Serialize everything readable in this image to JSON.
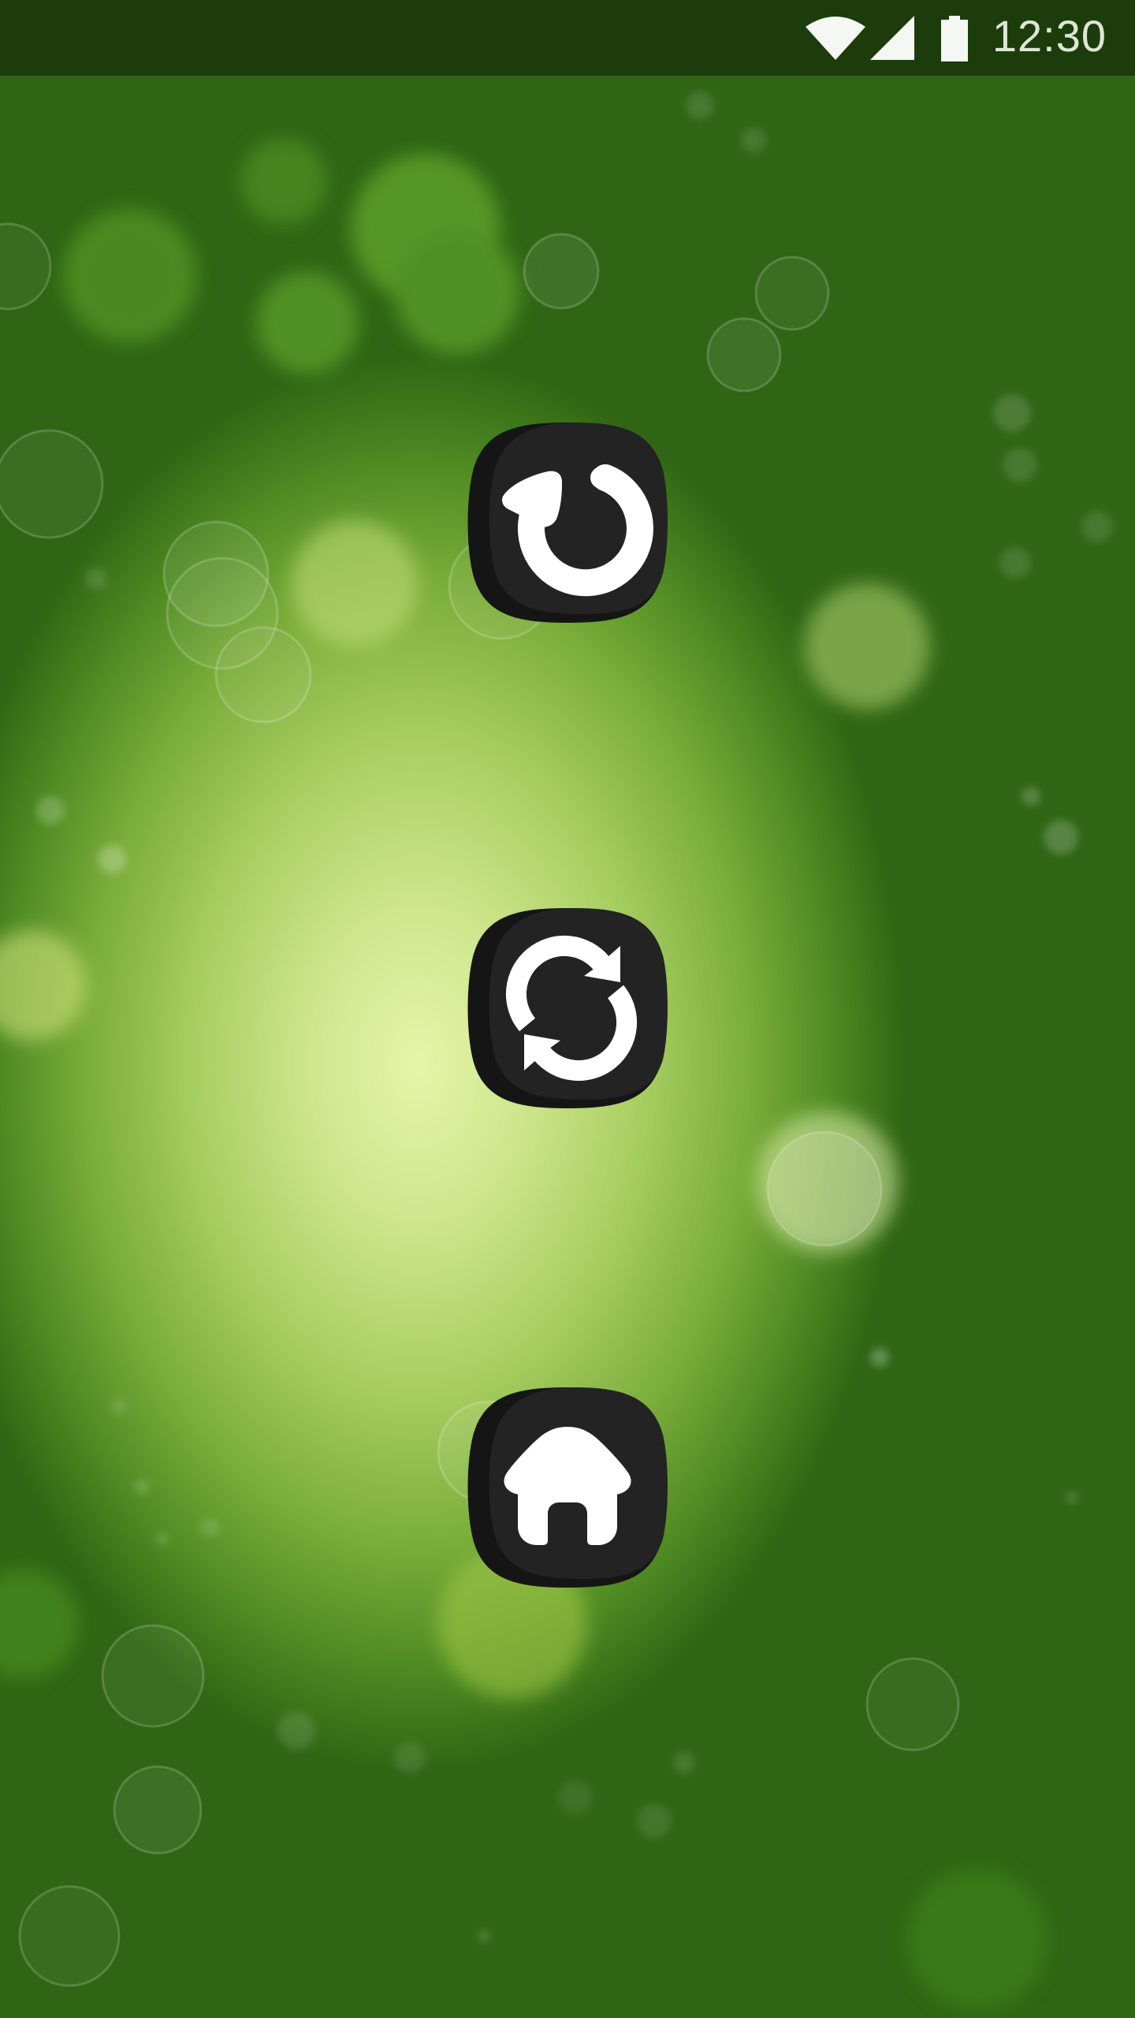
{
  "status_bar": {
    "time": "12:30",
    "icons": [
      "wifi-icon",
      "cellular-signal-icon",
      "battery-icon"
    ]
  },
  "background": {
    "description_colors": {
      "center": "#e6f5aa",
      "edge": "#2f6514"
    }
  },
  "actions": [
    {
      "icon": "rotate-left-icon"
    },
    {
      "icon": "sync-icon"
    },
    {
      "icon": "home-icon"
    }
  ],
  "colors": {
    "button_fill": "#232323",
    "button_shadow": "#141414",
    "icon_fill": "#ffffff",
    "status_text": "#e8eddf"
  }
}
